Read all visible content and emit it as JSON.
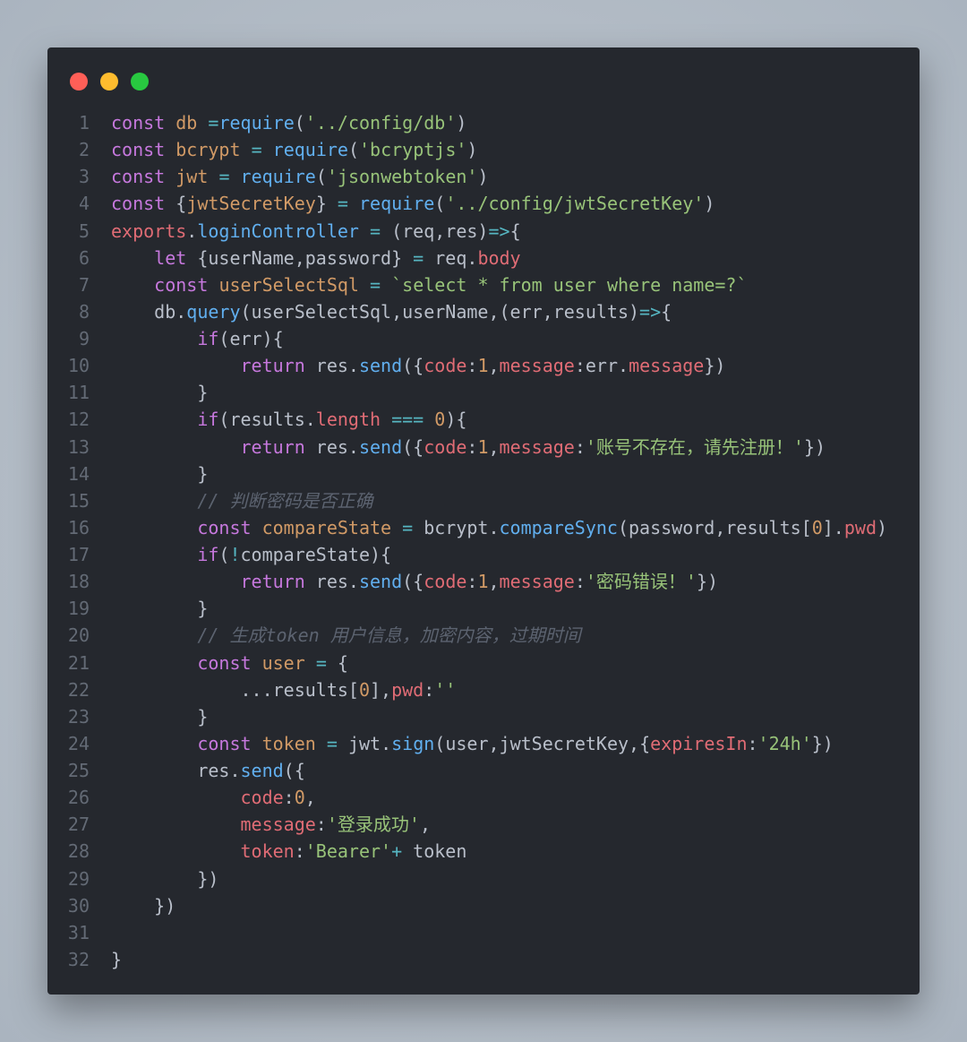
{
  "window": {
    "controls": [
      "close",
      "minimize",
      "maximize"
    ]
  },
  "colors": {
    "keyword": "#c678dd",
    "variable": "#d19a66",
    "function": "#61afef",
    "string": "#98c379",
    "property": "#e06c75",
    "operator": "#56b6c2",
    "comment": "#5c6370",
    "background": "#25282e"
  },
  "lines": [
    [
      [
        "k",
        "const"
      ],
      [
        "t",
        " "
      ],
      [
        "v",
        "db"
      ],
      [
        "t",
        " "
      ],
      [
        "o",
        "="
      ],
      [
        "f",
        "require"
      ],
      [
        "t",
        "("
      ],
      [
        "s",
        "'../config/db'"
      ],
      [
        "t",
        ")"
      ]
    ],
    [
      [
        "k",
        "const"
      ],
      [
        "t",
        " "
      ],
      [
        "v",
        "bcrypt"
      ],
      [
        "t",
        " "
      ],
      [
        "o",
        "="
      ],
      [
        "t",
        " "
      ],
      [
        "f",
        "require"
      ],
      [
        "t",
        "("
      ],
      [
        "s",
        "'bcryptjs'"
      ],
      [
        "t",
        ")"
      ]
    ],
    [
      [
        "k",
        "const"
      ],
      [
        "t",
        " "
      ],
      [
        "v",
        "jwt"
      ],
      [
        "t",
        " "
      ],
      [
        "o",
        "="
      ],
      [
        "t",
        " "
      ],
      [
        "f",
        "require"
      ],
      [
        "t",
        "("
      ],
      [
        "s",
        "'jsonwebtoken'"
      ],
      [
        "t",
        ")"
      ]
    ],
    [
      [
        "k",
        "const"
      ],
      [
        "t",
        " {"
      ],
      [
        "v",
        "jwtSecretKey"
      ],
      [
        "t",
        "} "
      ],
      [
        "o",
        "="
      ],
      [
        "t",
        " "
      ],
      [
        "f",
        "require"
      ],
      [
        "t",
        "("
      ],
      [
        "s",
        "'../config/jwtSecretKey'"
      ],
      [
        "t",
        ")"
      ]
    ],
    [
      [
        "p",
        "exports"
      ],
      [
        "t",
        "."
      ],
      [
        "f",
        "loginController"
      ],
      [
        "t",
        " "
      ],
      [
        "o",
        "="
      ],
      [
        "t",
        " (req,res)"
      ],
      [
        "o",
        "=>"
      ],
      [
        "t",
        "{"
      ]
    ],
    [
      [
        "t",
        "    "
      ],
      [
        "k",
        "let"
      ],
      [
        "t",
        " {userName,password} "
      ],
      [
        "o",
        "="
      ],
      [
        "t",
        " req."
      ],
      [
        "p",
        "body"
      ]
    ],
    [
      [
        "t",
        "    "
      ],
      [
        "k",
        "const"
      ],
      [
        "t",
        " "
      ],
      [
        "v",
        "userSelectSql"
      ],
      [
        "t",
        " "
      ],
      [
        "o",
        "="
      ],
      [
        "t",
        " "
      ],
      [
        "s",
        "`select * from user where name=?`"
      ]
    ],
    [
      [
        "t",
        "    db."
      ],
      [
        "f",
        "query"
      ],
      [
        "t",
        "(userSelectSql,userName,(err,results)"
      ],
      [
        "o",
        "=>"
      ],
      [
        "t",
        "{"
      ]
    ],
    [
      [
        "t",
        "        "
      ],
      [
        "k",
        "if"
      ],
      [
        "t",
        "(err){"
      ]
    ],
    [
      [
        "t",
        "            "
      ],
      [
        "k",
        "return"
      ],
      [
        "t",
        " res."
      ],
      [
        "f",
        "send"
      ],
      [
        "t",
        "({"
      ],
      [
        "p",
        "code"
      ],
      [
        "t",
        ":"
      ],
      [
        "n",
        "1"
      ],
      [
        "t",
        ","
      ],
      [
        "p",
        "message"
      ],
      [
        "t",
        ":err."
      ],
      [
        "p",
        "message"
      ],
      [
        "t",
        "})"
      ]
    ],
    [
      [
        "t",
        "        }"
      ]
    ],
    [
      [
        "t",
        "        "
      ],
      [
        "k",
        "if"
      ],
      [
        "t",
        "(results."
      ],
      [
        "p",
        "length"
      ],
      [
        "t",
        " "
      ],
      [
        "o",
        "==="
      ],
      [
        "t",
        " "
      ],
      [
        "n",
        "0"
      ],
      [
        "t",
        "){"
      ]
    ],
    [
      [
        "t",
        "            "
      ],
      [
        "k",
        "return"
      ],
      [
        "t",
        " res."
      ],
      [
        "f",
        "send"
      ],
      [
        "t",
        "({"
      ],
      [
        "p",
        "code"
      ],
      [
        "t",
        ":"
      ],
      [
        "n",
        "1"
      ],
      [
        "t",
        ","
      ],
      [
        "p",
        "message"
      ],
      [
        "t",
        ":"
      ],
      [
        "s",
        "'账号不存在，请先注册！'"
      ],
      [
        "t",
        "})"
      ]
    ],
    [
      [
        "t",
        "        }"
      ]
    ],
    [
      [
        "t",
        "        "
      ],
      [
        "c",
        "// 判断密码是否正确"
      ]
    ],
    [
      [
        "t",
        "        "
      ],
      [
        "k",
        "const"
      ],
      [
        "t",
        " "
      ],
      [
        "v",
        "compareState"
      ],
      [
        "t",
        " "
      ],
      [
        "o",
        "="
      ],
      [
        "t",
        " bcrypt."
      ],
      [
        "f",
        "compareSync"
      ],
      [
        "t",
        "(password,results["
      ],
      [
        "n",
        "0"
      ],
      [
        "t",
        "]."
      ],
      [
        "p",
        "pwd"
      ],
      [
        "t",
        ")"
      ]
    ],
    [
      [
        "t",
        "        "
      ],
      [
        "k",
        "if"
      ],
      [
        "t",
        "("
      ],
      [
        "o",
        "!"
      ],
      [
        "t",
        "compareState){"
      ]
    ],
    [
      [
        "t",
        "            "
      ],
      [
        "k",
        "return"
      ],
      [
        "t",
        " res."
      ],
      [
        "f",
        "send"
      ],
      [
        "t",
        "({"
      ],
      [
        "p",
        "code"
      ],
      [
        "t",
        ":"
      ],
      [
        "n",
        "1"
      ],
      [
        "t",
        ","
      ],
      [
        "p",
        "message"
      ],
      [
        "t",
        ":"
      ],
      [
        "s",
        "'密码错误！'"
      ],
      [
        "t",
        "})"
      ]
    ],
    [
      [
        "t",
        "        }"
      ]
    ],
    [
      [
        "t",
        "        "
      ],
      [
        "c",
        "// 生成token 用户信息，加密内容，过期时间"
      ]
    ],
    [
      [
        "t",
        "        "
      ],
      [
        "k",
        "const"
      ],
      [
        "t",
        " "
      ],
      [
        "v",
        "user"
      ],
      [
        "t",
        " "
      ],
      [
        "o",
        "="
      ],
      [
        "t",
        " {"
      ]
    ],
    [
      [
        "t",
        "            ...results["
      ],
      [
        "n",
        "0"
      ],
      [
        "t",
        "],"
      ],
      [
        "p",
        "pwd"
      ],
      [
        "t",
        ":"
      ],
      [
        "s",
        "''"
      ]
    ],
    [
      [
        "t",
        "        }"
      ]
    ],
    [
      [
        "t",
        "        "
      ],
      [
        "k",
        "const"
      ],
      [
        "t",
        " "
      ],
      [
        "v",
        "token"
      ],
      [
        "t",
        " "
      ],
      [
        "o",
        "="
      ],
      [
        "t",
        " jwt."
      ],
      [
        "f",
        "sign"
      ],
      [
        "t",
        "(user,jwtSecretKey,{"
      ],
      [
        "p",
        "expiresIn"
      ],
      [
        "t",
        ":"
      ],
      [
        "s",
        "'24h'"
      ],
      [
        "t",
        "})"
      ]
    ],
    [
      [
        "t",
        "        res."
      ],
      [
        "f",
        "send"
      ],
      [
        "t",
        "({"
      ]
    ],
    [
      [
        "t",
        "            "
      ],
      [
        "p",
        "code"
      ],
      [
        "t",
        ":"
      ],
      [
        "n",
        "0"
      ],
      [
        "t",
        ","
      ]
    ],
    [
      [
        "t",
        "            "
      ],
      [
        "p",
        "message"
      ],
      [
        "t",
        ":"
      ],
      [
        "s",
        "'登录成功'"
      ],
      [
        "t",
        ","
      ]
    ],
    [
      [
        "t",
        "            "
      ],
      [
        "p",
        "token"
      ],
      [
        "t",
        ":"
      ],
      [
        "s",
        "'Bearer'"
      ],
      [
        "o",
        "+"
      ],
      [
        "t",
        " token"
      ]
    ],
    [
      [
        "t",
        "        })"
      ]
    ],
    [
      [
        "t",
        "    })"
      ]
    ],
    [],
    [
      [
        "t",
        "}"
      ]
    ]
  ]
}
